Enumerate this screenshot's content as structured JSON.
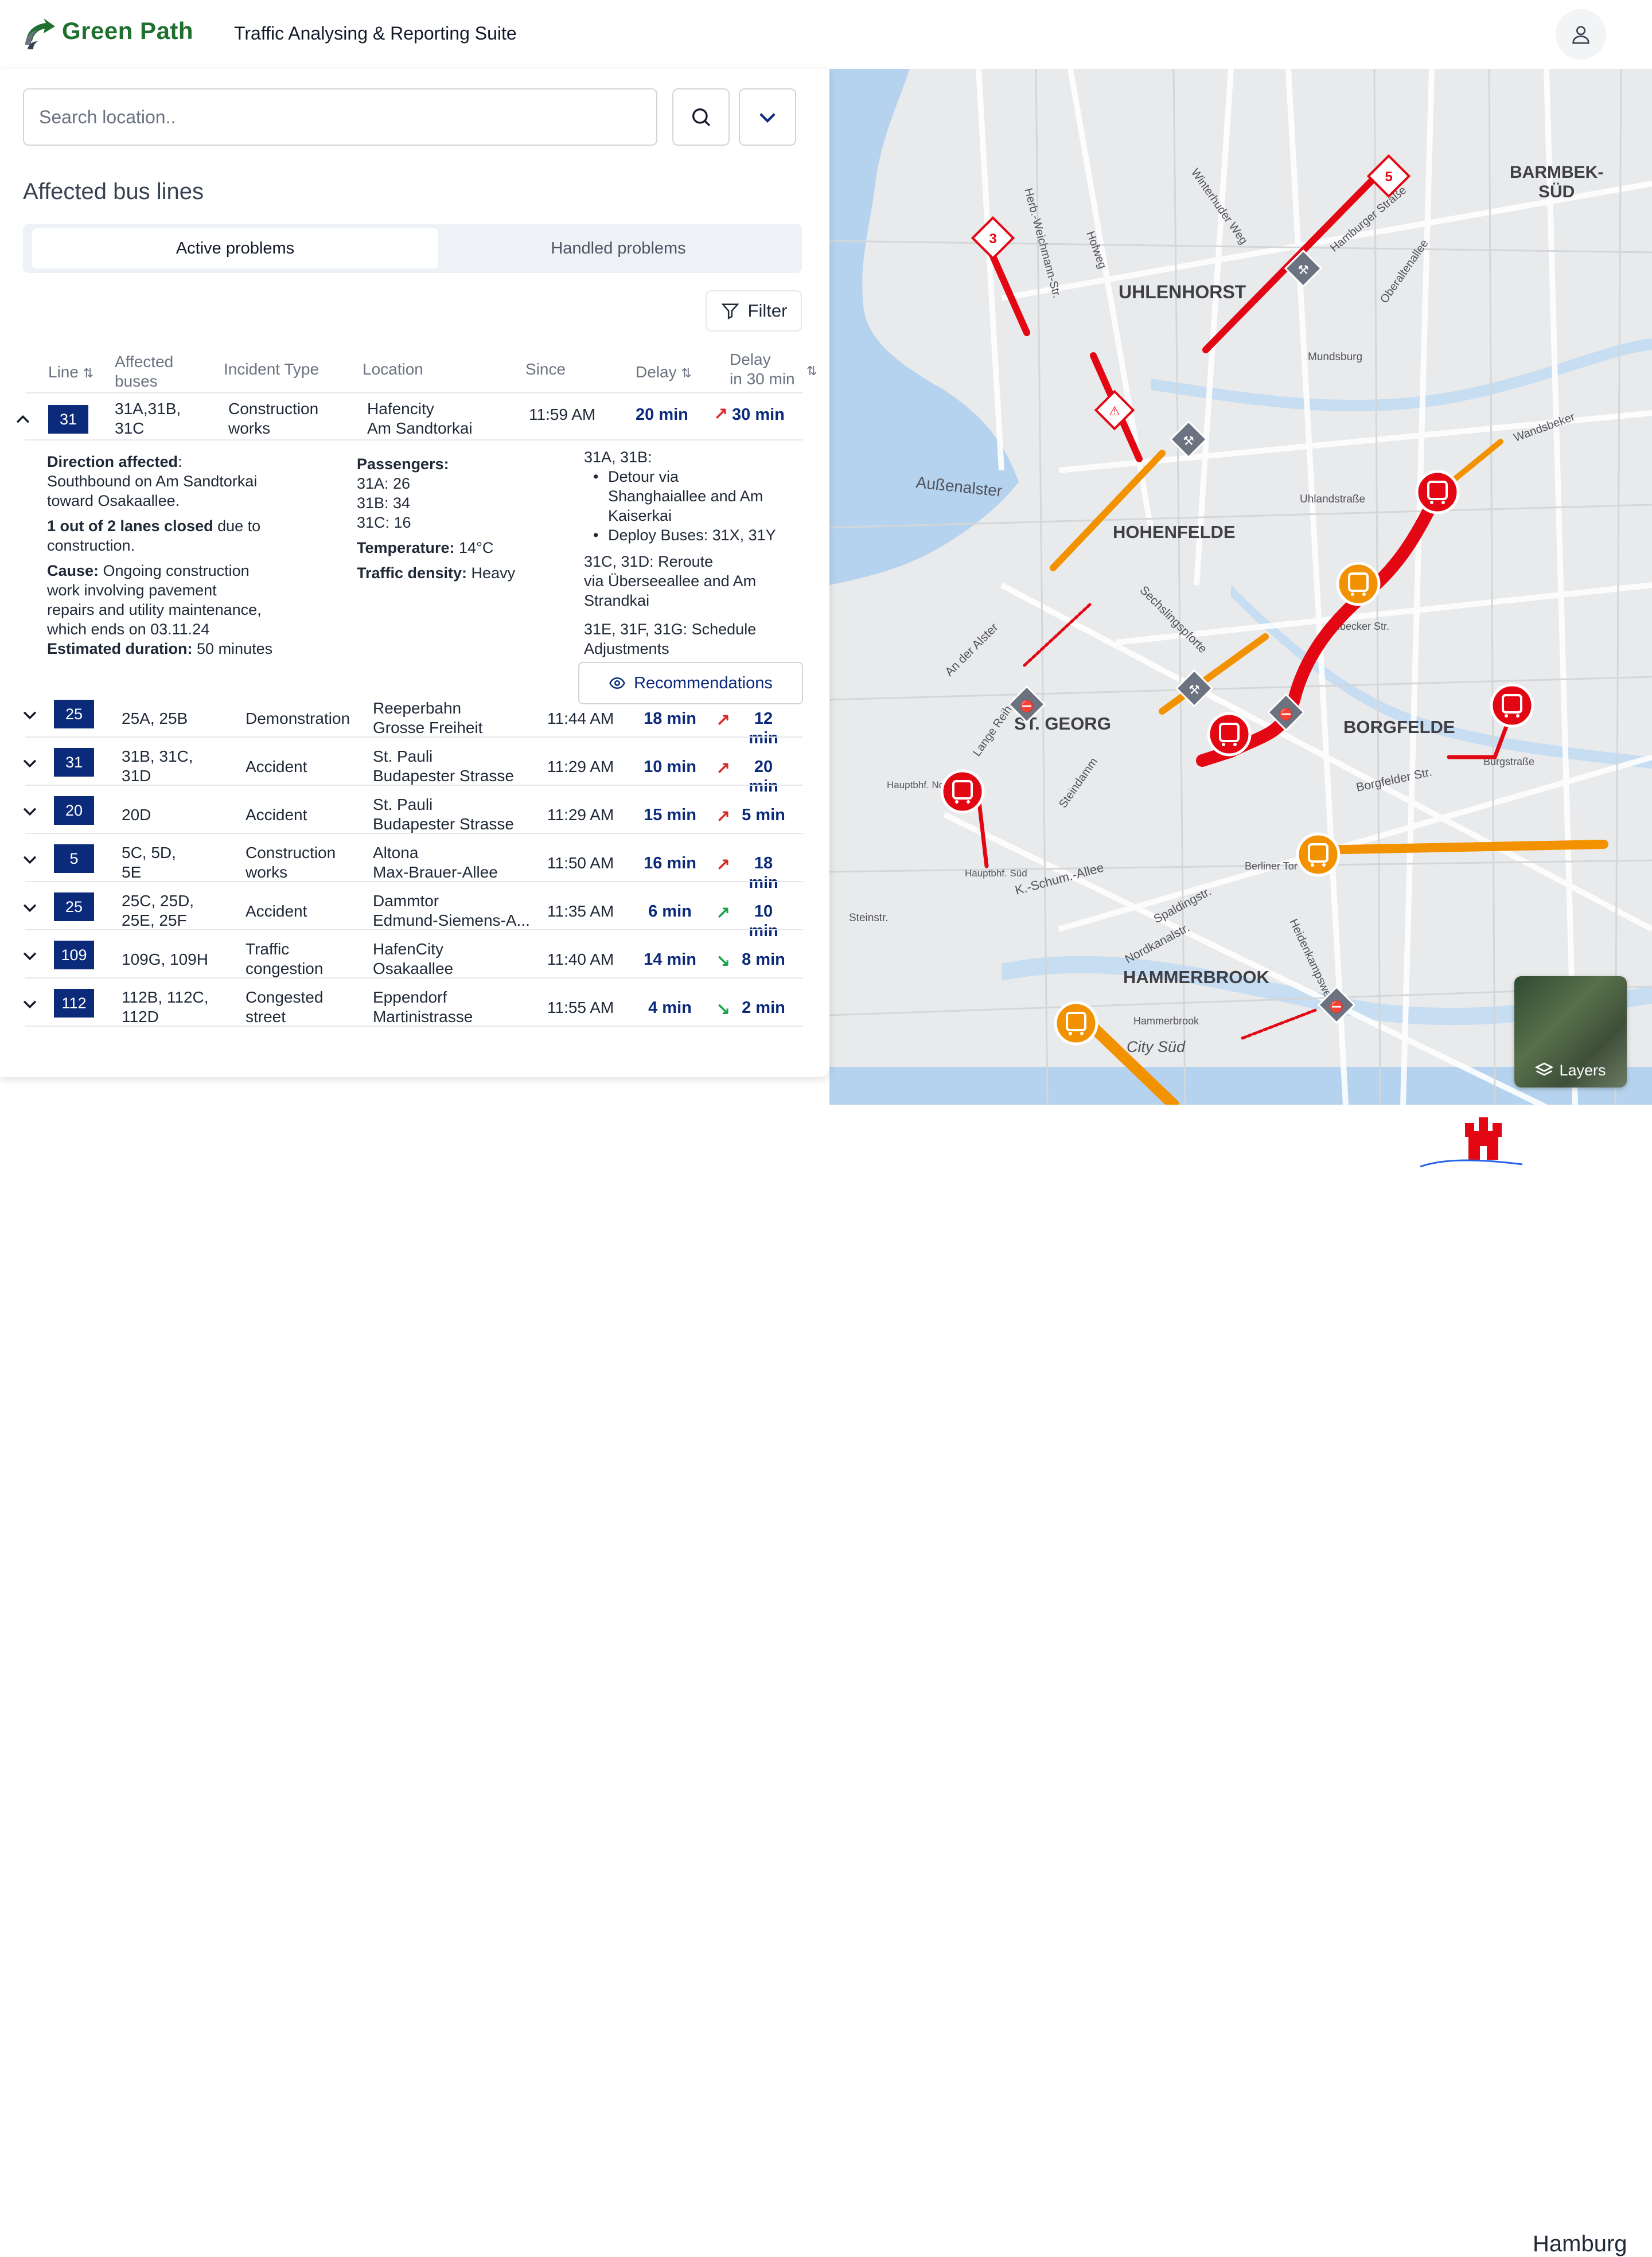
{
  "header": {
    "brand": "Green Path",
    "suite": "Traffic Analysing & Reporting Suite"
  },
  "search": {
    "placeholder": "Search location.."
  },
  "panel": {
    "heading": "Affected bus lines",
    "tabs": [
      "Active problems",
      "Handled problems"
    ],
    "filter_label": "Filter",
    "recommendations_label": "Recommendations"
  },
  "table": {
    "headers": {
      "line": "Line",
      "affected": [
        "Affected",
        "buses"
      ],
      "incident": "Incident Type",
      "location": "Location",
      "since": "Since",
      "delay": "Delay",
      "delay30": [
        "Delay",
        "in 30 min"
      ]
    },
    "rows": [
      {
        "line": "31",
        "buses": [
          "31A,31B,",
          "31C"
        ],
        "incident": [
          "Construction",
          "works"
        ],
        "location": [
          "Hafencity",
          "Am Sandtorkai"
        ],
        "since": "11:59 AM",
        "delay": "20 min",
        "trend": "up",
        "delay30": "30 min"
      },
      {
        "line": "25",
        "buses": [
          "25A, 25B"
        ],
        "incident": [
          "Demonstration"
        ],
        "location": [
          "Reeperbahn",
          "Grosse Freiheit"
        ],
        "since": "11:44 AM",
        "delay": "18 min",
        "trend": "up",
        "delay30": "12 min"
      },
      {
        "line": "31",
        "buses": [
          "31B, 31C,",
          "31D"
        ],
        "incident": [
          "Accident"
        ],
        "location": [
          "St. Pauli",
          "Budapester Strasse"
        ],
        "since": "11:29 AM",
        "delay": "10 min",
        "trend": "up",
        "delay30": "20 min"
      },
      {
        "line": "20",
        "buses": [
          "20D"
        ],
        "incident": [
          "Accident"
        ],
        "location": [
          "St. Pauli",
          "Budapester Strasse"
        ],
        "since": "11:29 AM",
        "delay": "15 min",
        "trend": "up",
        "delay30": "5 min"
      },
      {
        "line": "5",
        "buses": [
          "5C, 5D,",
          "5E"
        ],
        "incident": [
          "Construction",
          "works"
        ],
        "location": [
          "Altona",
          "Max-Brauer-Allee"
        ],
        "since": "11:50 AM",
        "delay": "16 min",
        "trend": "up",
        "delay30": "18 min"
      },
      {
        "line": "25",
        "buses": [
          "25C, 25D,",
          "25E, 25F"
        ],
        "incident": [
          "Accident"
        ],
        "location": [
          "Dammtor",
          "Edmund-Siemens-A..."
        ],
        "since": "11:35 AM",
        "delay": "6 min",
        "trend": "up-green",
        "delay30": "10 min"
      },
      {
        "line": "109",
        "buses": [
          "109G, 109H"
        ],
        "incident": [
          "Traffic",
          "congestion"
        ],
        "location": [
          "HafenCity",
          "Osakaallee"
        ],
        "since": "11:40 AM",
        "delay": "14 min",
        "trend": "down",
        "delay30": "8 min"
      },
      {
        "line": "112",
        "buses": [
          "112B, 112C,",
          "112D"
        ],
        "incident": [
          "Congested",
          "street"
        ],
        "location": [
          "Eppendorf",
          "Martinistrasse"
        ],
        "since": "11:55 AM",
        "delay": "4 min",
        "trend": "down",
        "delay30": "2 min"
      }
    ]
  },
  "details": {
    "direction_label": "Direction affected",
    "direction_text": [
      "Southbound on Am Sandtorkai",
      "toward Osakaallee."
    ],
    "lanes_bold": "1 out of 2 lanes closed",
    "lanes_text_1": " due to",
    "lanes_text_2": "construction.",
    "cause_label": "Cause:",
    "cause_text": [
      " Ongoing construction",
      "work involving pavement",
      "repairs and utility maintenance,",
      "which ends on 03.11.24"
    ],
    "duration_label": "Estimated duration:",
    "duration_value": " 50 minutes",
    "passengers_label": "Passengers:",
    "passengers": [
      "31A: 26",
      "31B: 34",
      "31C: 16"
    ],
    "temperature_label": "Temperature:",
    "temperature_value": " 14°C",
    "density_label": "Traffic density:",
    "density_value": " Heavy",
    "reco_head": "31A, 31B:",
    "reco_bullets": [
      [
        "Detour via",
        "Shanghaiallee and Am",
        "Kaiserkai"
      ],
      [
        "Deploy Buses: 31X, 31Y"
      ]
    ],
    "reco_2": [
      "31C, 31D: Reroute",
      "via Überseeallee and Am",
      "Strandkai"
    ],
    "reco_3": [
      "31E, 31F, 31G: Schedule",
      "Adjustments"
    ]
  },
  "map": {
    "labels": [
      "BARMBEK-",
      "SÜD",
      "UHLENHORST",
      "HOHENFELDE",
      "Außenalster",
      "ST. GEORG",
      "BORGFELDE",
      "HAMMERBROOK",
      "City Süd",
      "Wandsbeker",
      "Mundsburg",
      "Uhlandstraße",
      "Burgstraße",
      "Berliner Tor",
      "Hammerbrook",
      "Lübecker Str.",
      "Sechslingspforte",
      "An der Alster",
      "Lange Reihe",
      "Steindamm",
      "Borgfelder Str.",
      "Spaldingstr.",
      "Nordkanalstr.",
      "Heidenkampsweg",
      "K.-Schum.-Allee",
      "Hamburger Straße",
      "Herb.-Weichmann-Str.",
      "Hofweg",
      "Winterhuder Weg",
      "Oberaltenallee",
      "Steinstr.",
      "Hauptbhf. Süd",
      "Hauptbhf. Nord"
    ],
    "incident_numbers": [
      "3",
      "5"
    ],
    "layers_label": "Layers"
  },
  "footer": {
    "city": "Hamburg"
  },
  "colors": {
    "accent": "#0b2a7a",
    "brand": "#1f6f2e",
    "severe": "#e30613",
    "moderate": "#f39200"
  }
}
